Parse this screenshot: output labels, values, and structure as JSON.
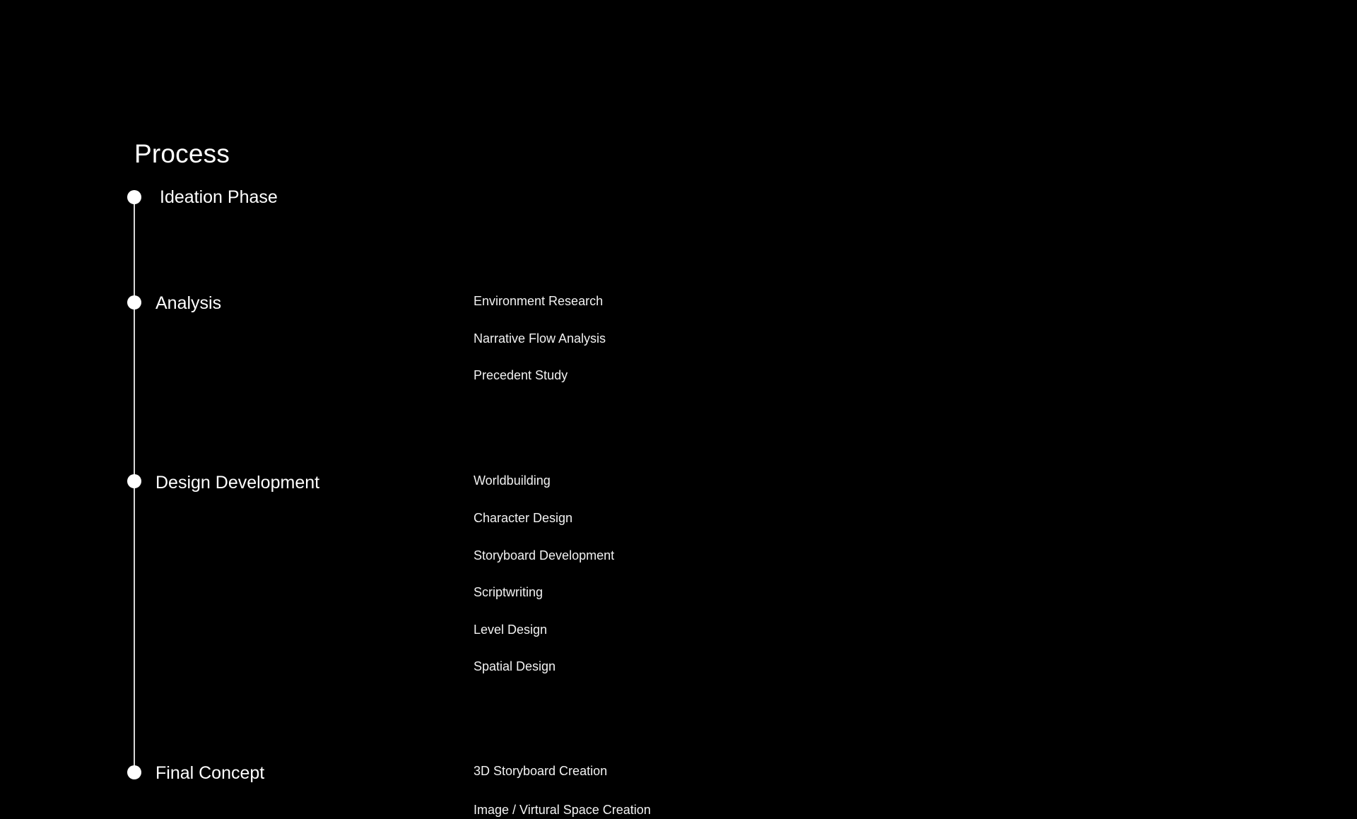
{
  "title": "Process",
  "stages": [
    {
      "label": "Ideation Phase",
      "steps": []
    },
    {
      "label": "Analysis",
      "steps": [
        "Environment Research",
        "Narrative Flow Analysis",
        "Precedent Study"
      ]
    },
    {
      "label": "Design Development",
      "steps": [
        "Worldbuilding",
        "Character Design",
        "Storyboard Development",
        "Scriptwriting",
        "Level Design",
        "Spatial Design"
      ]
    },
    {
      "label": "Final Concept",
      "steps": [
        "3D Storyboard Creation",
        "Image / Virtural Space Creation"
      ]
    }
  ],
  "colors": {
    "background": "#000000",
    "text": "#ffffff",
    "timeline": "#d9d9d9"
  }
}
